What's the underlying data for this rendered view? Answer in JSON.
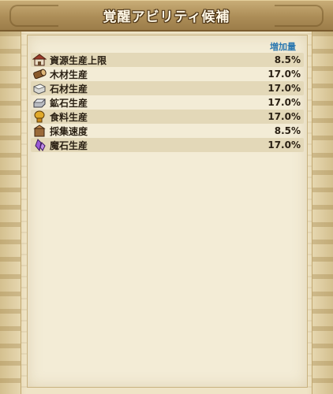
{
  "title": "覚醒アビリティ候補",
  "table": {
    "header_value": "増加量",
    "rows": [
      {
        "name": "資源生産上限",
        "value": "8.5%",
        "icon": "storehouse-icon"
      },
      {
        "name": "木材生産",
        "value": "17.0%",
        "icon": "wood-log-icon"
      },
      {
        "name": "石材生産",
        "value": "17.0%",
        "icon": "stone-block-icon"
      },
      {
        "name": "鉱石生産",
        "value": "17.0%",
        "icon": "ore-ingot-icon"
      },
      {
        "name": "食料生産",
        "value": "17.0%",
        "icon": "food-wheat-icon"
      },
      {
        "name": "採集速度",
        "value": "8.5%",
        "icon": "gathering-box-icon"
      },
      {
        "name": "魔石生産",
        "value": "17.0%",
        "icon": "magic-crystal-icon"
      }
    ]
  },
  "colors": {
    "header_text": "#2e79b0",
    "row_shade": "#e3d8b8",
    "title_bar": "#ad8e58"
  }
}
